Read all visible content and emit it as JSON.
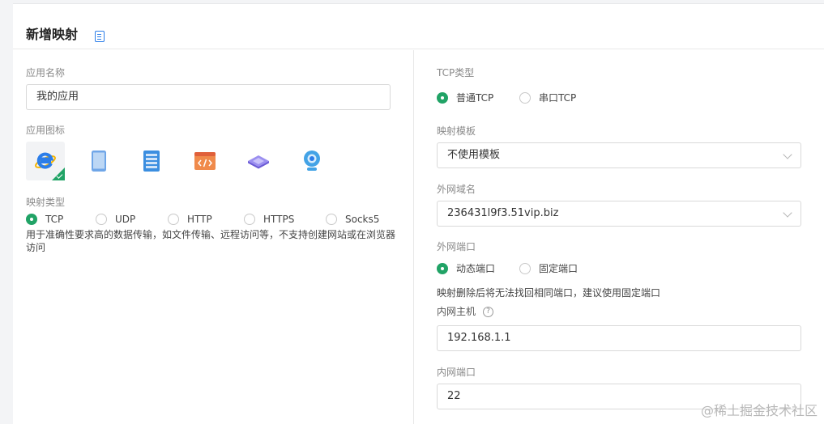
{
  "header": {
    "title": "新增映射",
    "doc_icon": "document-icon"
  },
  "app_name": {
    "label": "应用名称",
    "value": "我的应用"
  },
  "app_icon": {
    "label": "应用图标",
    "options": [
      {
        "name": "ie-browser-icon",
        "selected": true
      },
      {
        "name": "tablet-icon",
        "selected": false
      },
      {
        "name": "server-icon",
        "selected": false
      },
      {
        "name": "code-window-icon",
        "selected": false
      },
      {
        "name": "layers-icon",
        "selected": false
      },
      {
        "name": "webcam-icon",
        "selected": false
      }
    ]
  },
  "mapping_type": {
    "label": "映射类型",
    "options": [
      "TCP",
      "UDP",
      "HTTP",
      "HTTPS",
      "Socks5"
    ],
    "selected": "TCP",
    "description": "用于准确性要求高的数据传输，如文件传输、远程访问等，不支持创建网站或在浏览器访问"
  },
  "tcp_type": {
    "label": "TCP类型",
    "options": [
      "普通TCP",
      "串口TCP"
    ],
    "selected": "普通TCP"
  },
  "mapping_template": {
    "label": "映射模板",
    "value": "不使用模板"
  },
  "public_domain": {
    "label": "外网域名",
    "value": "236431l9f3.51vip.biz"
  },
  "public_port": {
    "label": "外网端口",
    "options": [
      "动态端口",
      "固定端口"
    ],
    "selected": "动态端口",
    "hint": "映射删除后将无法找回相同端口，建议使用固定端口"
  },
  "internal_host": {
    "label": "内网主机",
    "value": "192.168.1.1",
    "help": "?"
  },
  "internal_port": {
    "label": "内网端口",
    "value": "22"
  },
  "watermark": "@稀土掘金技术社区",
  "colors": {
    "accent": "#21a366",
    "border": "#d9d9d9",
    "label": "#8a8a8a",
    "link": "#2b7de9"
  }
}
